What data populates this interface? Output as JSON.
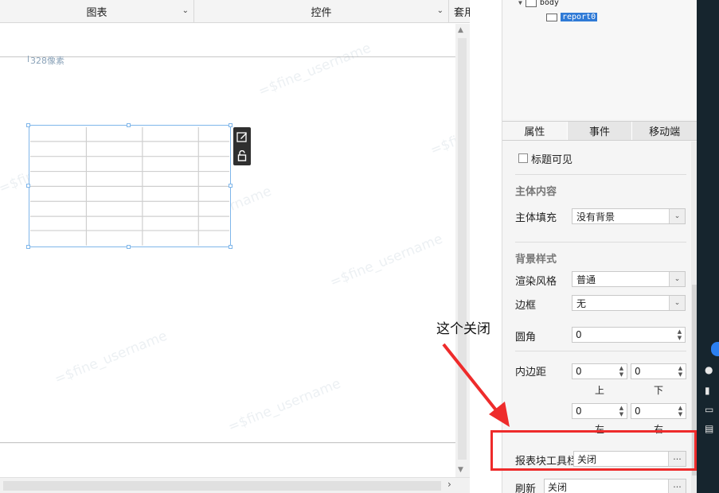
{
  "top_tabs": [
    {
      "label": "图表"
    },
    {
      "label": "控件"
    },
    {
      "label": "套用"
    }
  ],
  "canvas": {
    "size_label": "328像素",
    "watermark": "=$fine_username"
  },
  "widget_tools": {
    "edit_icon": "edit-icon",
    "lock_icon": "unlock-icon"
  },
  "tree": {
    "body_label": "body",
    "report_label": "report0"
  },
  "property_tabs": [
    {
      "label": "属性",
      "active": true
    },
    {
      "label": "事件",
      "active": false
    },
    {
      "label": "移动端",
      "active": false
    }
  ],
  "properties": {
    "title_visible_label": "标题可见",
    "main_content_title": "主体内容",
    "main_fill_label": "主体填充",
    "main_fill_value": "没有背景",
    "bg_style_title": "背景样式",
    "render_style_label": "渲染风格",
    "render_style_value": "普通",
    "border_label": "边框",
    "border_value": "无",
    "radius_label": "圆角",
    "radius_value": "0",
    "padding_label": "内边距",
    "padding_top": "0",
    "padding_bottom": "0",
    "padding_left": "0",
    "padding_right": "0",
    "top_label": "上",
    "bottom_label": "下",
    "left_label": "左",
    "right_label": "右",
    "toolbar_label": "报表块工具栏",
    "toolbar_value": "关闭",
    "refresh_label": "刷新",
    "refresh_value": "关闭",
    "more_button": "···"
  },
  "annotation": {
    "text": "这个关闭",
    "color": "#ee2b2b"
  }
}
